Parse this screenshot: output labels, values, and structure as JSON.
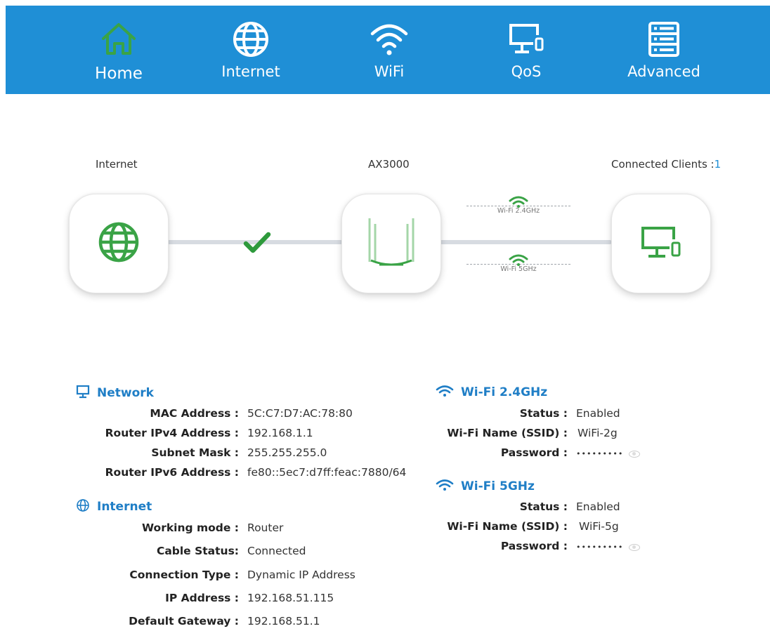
{
  "nav": {
    "items": [
      {
        "label": "Home",
        "icon": "home-icon",
        "active": true
      },
      {
        "label": "Internet",
        "icon": "globe-icon",
        "active": false
      },
      {
        "label": "WiFi",
        "icon": "wifi-icon",
        "active": false
      },
      {
        "label": "QoS",
        "icon": "monitor-phone-icon",
        "active": false
      },
      {
        "label": "Advanced",
        "icon": "list-panel-icon",
        "active": false
      }
    ],
    "bar_color": "#1f8fd6",
    "active_icon_color": "#3aa346"
  },
  "topology": {
    "internet_label": "Internet",
    "router_label": "AX3000",
    "clients_label": "Connected Clients :",
    "clients_count": "1",
    "band_24_label": "Wi-Fi 2.4GHz",
    "band_5_label": "Wi-Fi 5GHz",
    "status_icon": "check-icon",
    "accent_color": "#3aa346"
  },
  "network": {
    "title": "Network",
    "rows": [
      {
        "key": "MAC Address :",
        "value": "5C:C7:D7:AC:78:80"
      },
      {
        "key": "Router IPv4 Address :",
        "value": "192.168.1.1"
      },
      {
        "key": "Subnet Mask :",
        "value": "255.255.255.0"
      },
      {
        "key": "Router IPv6 Address :",
        "value": "fe80::5ec7:d7ff:feac:7880/64"
      }
    ]
  },
  "internet": {
    "title": "Internet",
    "rows": [
      {
        "key": "Working mode :",
        "value": "Router"
      },
      {
        "key": "Cable Status:",
        "value": "Connected"
      },
      {
        "key": "Connection Type :",
        "value": "Dynamic IP Address"
      },
      {
        "key": "IP Address :",
        "value": "192.168.51.115"
      },
      {
        "key": "Default Gateway :",
        "value": "192.168.51.1"
      }
    ]
  },
  "wifi24": {
    "title": "Wi-Fi 2.4GHz",
    "rows": [
      {
        "key": "Status :",
        "value": "Enabled"
      },
      {
        "key": "Wi-Fi Name (SSID) :",
        "value": "WiFi-2g"
      },
      {
        "key": "Password :",
        "value": "•••••••••"
      }
    ]
  },
  "wifi5": {
    "title": "Wi-Fi 5GHz",
    "rows": [
      {
        "key": "Status :",
        "value": "Enabled"
      },
      {
        "key": "Wi-Fi Name (SSID) :",
        "value": "WiFi-5g"
      },
      {
        "key": "Password :",
        "value": "•••••••••"
      }
    ]
  },
  "section_title_color": "#1f7ec6"
}
